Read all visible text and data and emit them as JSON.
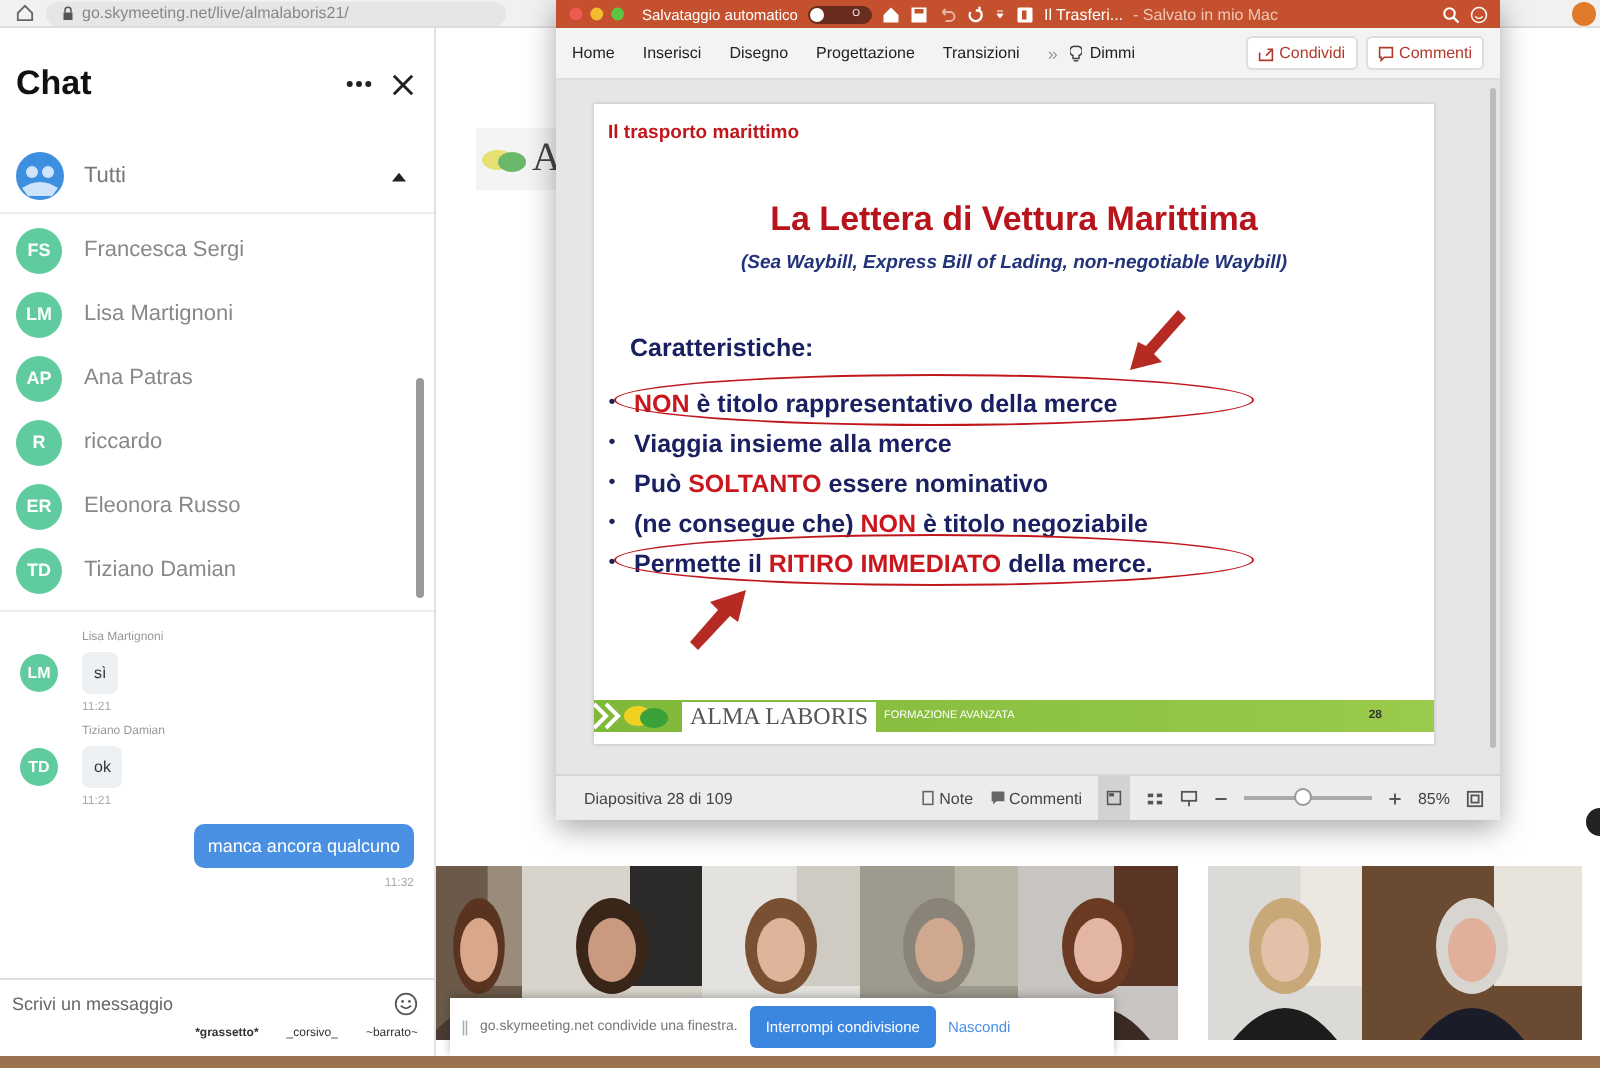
{
  "browser": {
    "url": "go.skymeeting.net/live/almalaboris21/"
  },
  "chat": {
    "title": "Chat",
    "group": {
      "label": "Tutti",
      "expanded": true
    },
    "participants": [
      {
        "initials": "FS",
        "name": "Francesca Sergi"
      },
      {
        "initials": "LM",
        "name": "Lisa Martignoni"
      },
      {
        "initials": "AP",
        "name": "Ana Patras"
      },
      {
        "initials": "R",
        "name": "riccardo"
      },
      {
        "initials": "ER",
        "name": "Eleonora Russo"
      },
      {
        "initials": "TD",
        "name": "Tiziano Damian"
      }
    ],
    "messages": [
      {
        "outgoing": false,
        "initials": "LM",
        "sender": "Lisa Martignoni",
        "text": "sì",
        "time": "11:21"
      },
      {
        "outgoing": false,
        "initials": "TD",
        "sender": "Tiziano Damian",
        "text": "ok",
        "time": "11:21"
      },
      {
        "outgoing": true,
        "text": "manca ancora qualcuno",
        "time": "11:32"
      }
    ],
    "input": {
      "placeholder": "Scrivi un messaggio"
    },
    "format_hints": [
      "*grassetto*",
      "_corsivo_",
      "~barrato~"
    ]
  },
  "stage_logo": {
    "text": "A"
  },
  "powerpoint": {
    "autosave": {
      "label": "Salvataggio automatico",
      "on": false,
      "toggle_text": "O"
    },
    "document_title": "Il Trasferi...",
    "save_status": "- Salvato in mio Mac",
    "ribbon_tabs": [
      "Home",
      "Inserisci",
      "Disegno",
      "Progettazione",
      "Transizioni"
    ],
    "overflow": "»",
    "search": "Dimmi",
    "buttons": [
      {
        "label": "Condividi",
        "kind": "share"
      },
      {
        "label": "Commenti",
        "kind": "comments"
      }
    ],
    "slide": {
      "section": "Il trasporto marittimo",
      "title": "La Lettera di Vettura Marittima",
      "subtitle": "(Sea Waybill, Express Bill of Lading, non-negotiable Waybill)",
      "heading": "Caratteristiche:",
      "marker": "•",
      "bullets": [
        {
          "text": "**NON** è titolo rappresentativo della merce",
          "circled": true
        },
        {
          "text": "Viaggia insieme alla merce",
          "circled": false
        },
        {
          "text": "Può **SOLTANTO** essere nominativo",
          "circled": false
        },
        {
          "text": "(ne consegue che) **NON** è titolo negoziabile",
          "circled": false
        },
        {
          "text": "Permette il **RITIRO IMMEDIATO** della merce.",
          "circled": true
        }
      ],
      "footer": {
        "brand": "ALMA LABORIS",
        "tagline": "FORMAZIONE AVANZATA",
        "page": "28"
      }
    },
    "status_bar": {
      "slide_counter": "Diapositiva 28 di 109",
      "notes": "Note",
      "comments": "Commenti",
      "zoom": {
        "level": 0.45
      },
      "zoom_text": "85%"
    }
  },
  "share_bar": {
    "message": "go.skymeeting.net condivide una finestra.",
    "stop_button": "Interrompi condivisione",
    "hide_link": "Nascondi"
  }
}
